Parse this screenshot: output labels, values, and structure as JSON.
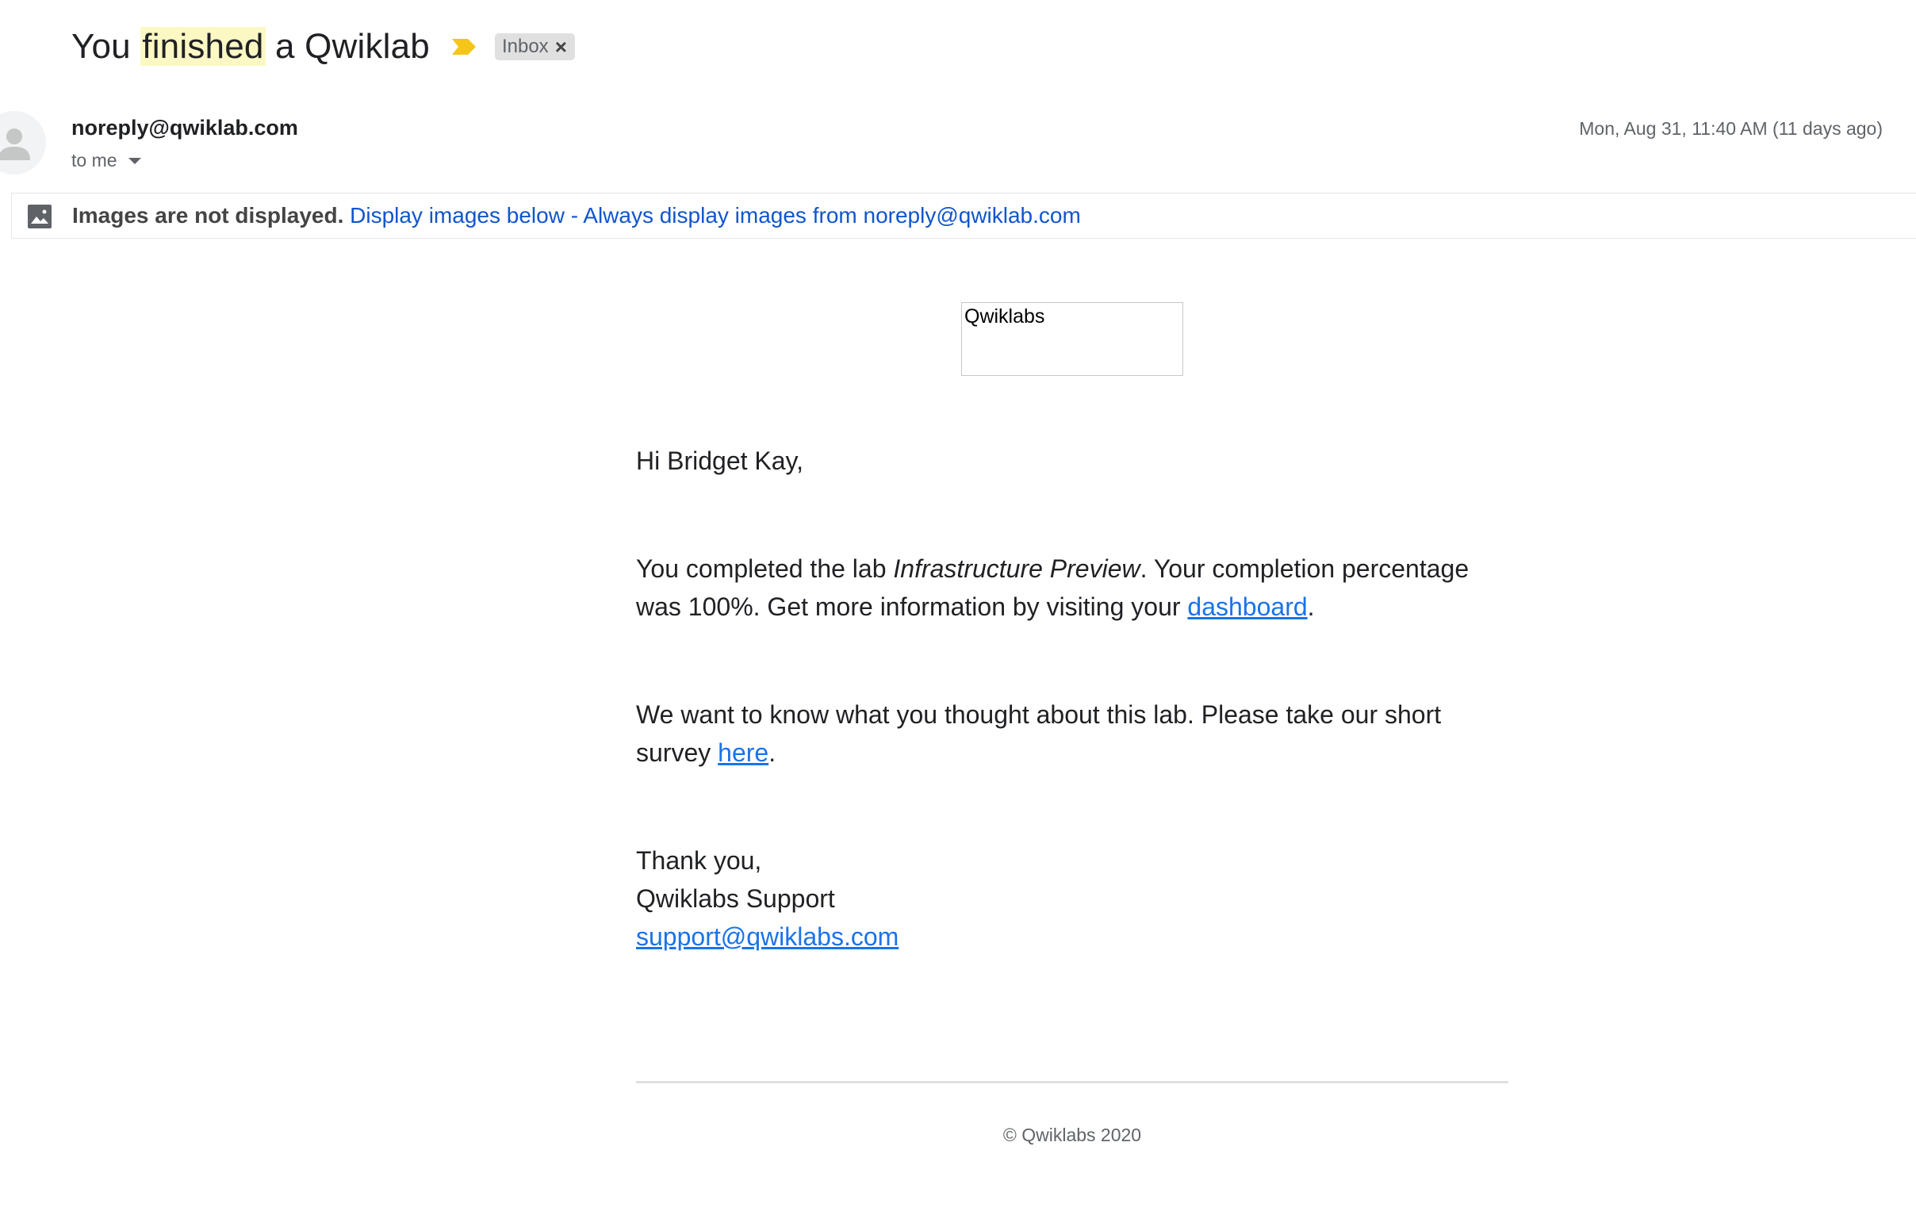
{
  "email": {
    "subject": {
      "before": "You ",
      "highlight": "finished",
      "after": " a Qwiklab"
    },
    "importance_icon": "importance-marker-icon",
    "label": {
      "text": "Inbox",
      "close_glyph": "×"
    },
    "sender": "noreply@qwiklab.com",
    "recipient": "to me",
    "timestamp": "Mon, Aug 31, 11:40 AM (11 days ago)"
  },
  "images_banner": {
    "icon": "image-icon",
    "bold_text": "Images are not displayed.",
    "display_link": "Display images below",
    "separator": " - ",
    "always_link": "Always display images from noreply@qwiklab.com"
  },
  "body": {
    "logo_alt": "Qwiklabs",
    "greeting": "Hi Bridget Kay,",
    "p1_before": "You completed the lab ",
    "p1_lab_name": "Infrastructure Preview",
    "p1_after": ". Your completion percentage was 100%. Get more information by visiting your ",
    "p1_link": "dashboard",
    "p1_end": ".",
    "p2_before": "We want to know what you thought about this lab. Please take our short survey ",
    "p2_link": "here",
    "p2_end": ".",
    "signoff": "Thank you,",
    "signature": "Qwiklabs Support",
    "support_email": "support@qwiklabs.com",
    "footer": "© Qwiklabs 2020"
  },
  "colors": {
    "link": "#1a73e8",
    "banner_link": "#1155cc",
    "highlight": "#fcf8c4",
    "importance": "#f5c518"
  }
}
